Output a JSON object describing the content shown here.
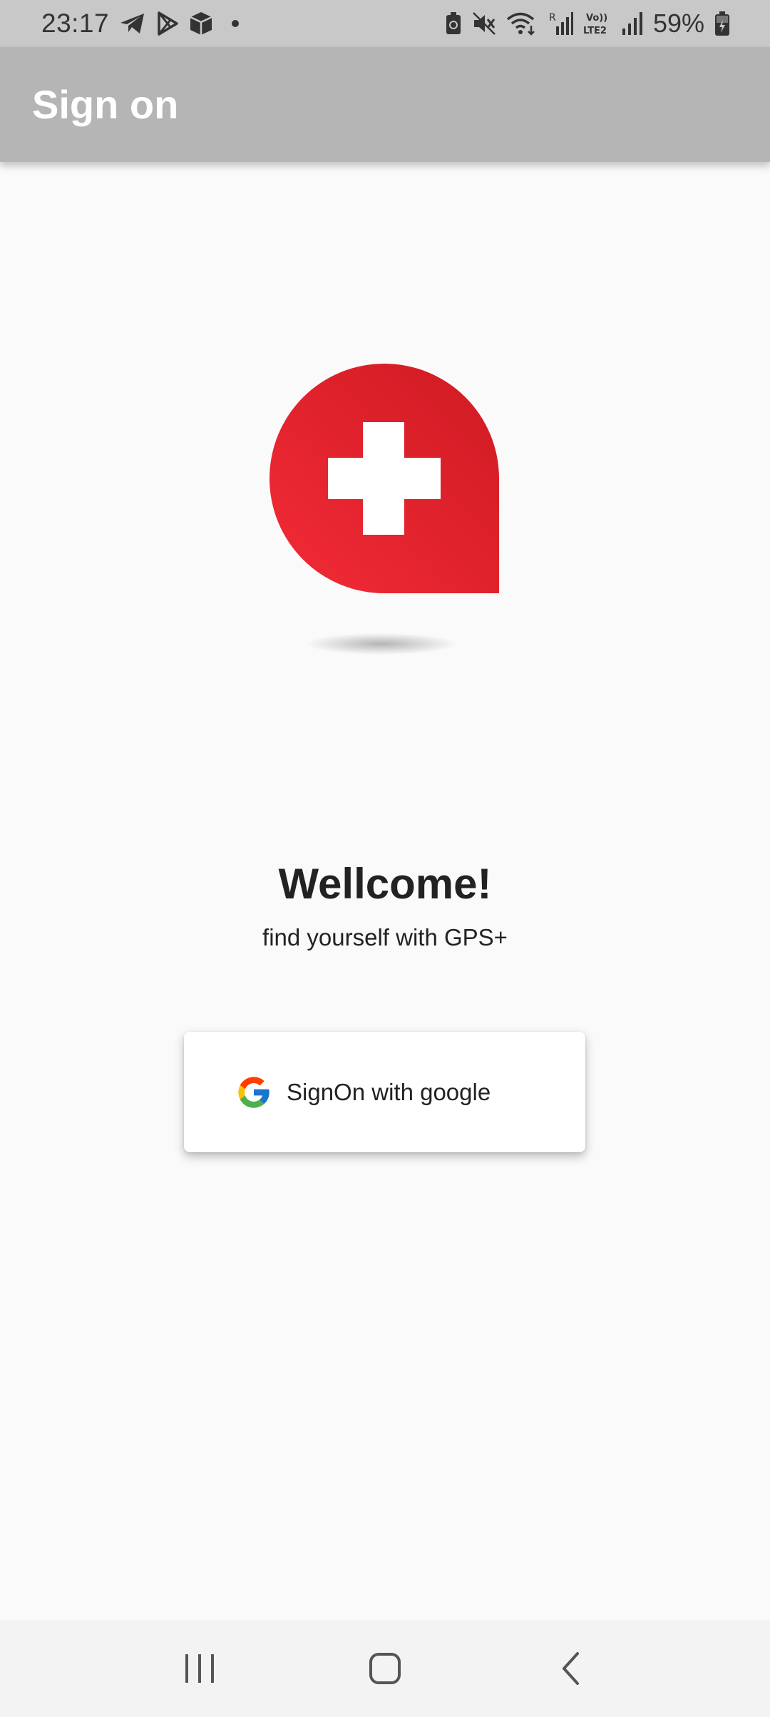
{
  "status_bar": {
    "time": "23:17",
    "battery_percent": "59%",
    "left_icons": [
      "telegram-icon",
      "play-store-icon",
      "package-icon",
      "notification-dot-icon"
    ],
    "right_icons": [
      "battery-saver-icon",
      "mute-icon",
      "wifi-icon",
      "signal-r-icon",
      "volte-lte2-icon",
      "signal-icon",
      "battery-charging-icon"
    ]
  },
  "app_bar": {
    "title": "Sign on",
    "background": "#b5b5b5"
  },
  "logo": {
    "icon": "red-cross-location-pin-icon",
    "color": "#e32630"
  },
  "welcome": {
    "title": "Wellcome!",
    "subtitle": "find yourself with GPS+"
  },
  "sign_on_button": {
    "icon": "google-icon",
    "label": "SignOn with google"
  },
  "nav_bar": {
    "buttons": [
      "recent-apps-icon",
      "home-icon",
      "back-icon"
    ]
  }
}
